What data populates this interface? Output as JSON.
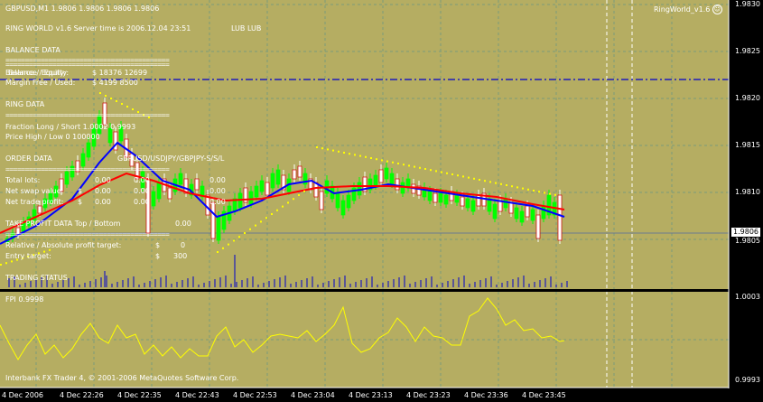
{
  "chart_header": "GBPUSD,M1  1.9806 1.9806 1.9806 1.9806",
  "indicator_name": "RingWorld_v1.6",
  "ea_title": "RING WORLD v1.6   Server time is 2006.12.04 23:51",
  "ea_flags": "LUB  LUB",
  "balance": {
    "header": "BALANCE DATA",
    "separator": "==========================================",
    "row1": "Balance / Equity:",
    "row1_overlap": "Balance / Equity:",
    "row1_value": "$      18376        12699",
    "row2": "Margin Free / Used:",
    "row2_value": "$      4199          8500"
  },
  "ring": {
    "header": "RING DATA",
    "separator": "==========================================",
    "row1": "Fraction Long / Short  1.0002        0.9993",
    "row2": "Price High / Low              0          100000"
  },
  "order": {
    "header": "ORDER DATA",
    "pairs": "GBPUSD/USDJPY/GBPJPY-S/S/L",
    "separator": "==========================================",
    "row1_label": "Total lots:",
    "row1_values": [
      "0.00",
      "0.00",
      "0.00"
    ],
    "row2_label": "Net swap value:",
    "row2_values": [
      "$",
      "0.00",
      "0.00",
      "0.00"
    ],
    "row3_label": "Net trade profit:",
    "row3_values": [
      "$",
      "0.00",
      "0.00",
      "0.00"
    ]
  },
  "take_profit": {
    "header": "TAKE PROFIT DATA     Top / Bottom",
    "header_value": "0.00",
    "separator": "==========================================",
    "row1": "Relative / Absolute profit target:",
    "row1_values": [
      "$",
      "0"
    ],
    "row2": "Entry target:",
    "row2_values": [
      "$",
      "300"
    ]
  },
  "trading_status": {
    "header": "TRADING STATUS"
  },
  "subwindow": {
    "title": "FPI 0.9998",
    "top_label": "1.0003",
    "bottom_label": "0.9993",
    "copyright": "Interbank FX Trader 4, © 2001-2006 MetaQuotes Software Corp."
  },
  "price_axis": [
    "1.9830",
    "1.9825",
    "1.9820",
    "1.9815",
    "1.9810",
    "1.9806",
    "1.9805"
  ],
  "current_price": "1.9806",
  "time_axis": [
    "4 Dec 2006",
    "4 Dec 22:26",
    "4 Dec 22:35",
    "4 Dec 22:43",
    "4 Dec 22:53",
    "4 Dec 23:04",
    "4 Dec 23:13",
    "4 Dec 23:23",
    "4 Dec 23:36",
    "4 Dec 23:45"
  ],
  "colors": {
    "background": "#000000",
    "chart_bg": "#b5ad62",
    "grid": "#7a9a7a",
    "bull": "#00ff00",
    "bear": "#ffffff",
    "ma_fast": "#0000ff",
    "ma_slow": "#ff0000",
    "sar": "#ffff00",
    "hline": "#0000cc",
    "fpi_line": "#ffff00",
    "volume": "#0000cc",
    "text": "#ffffff"
  }
}
